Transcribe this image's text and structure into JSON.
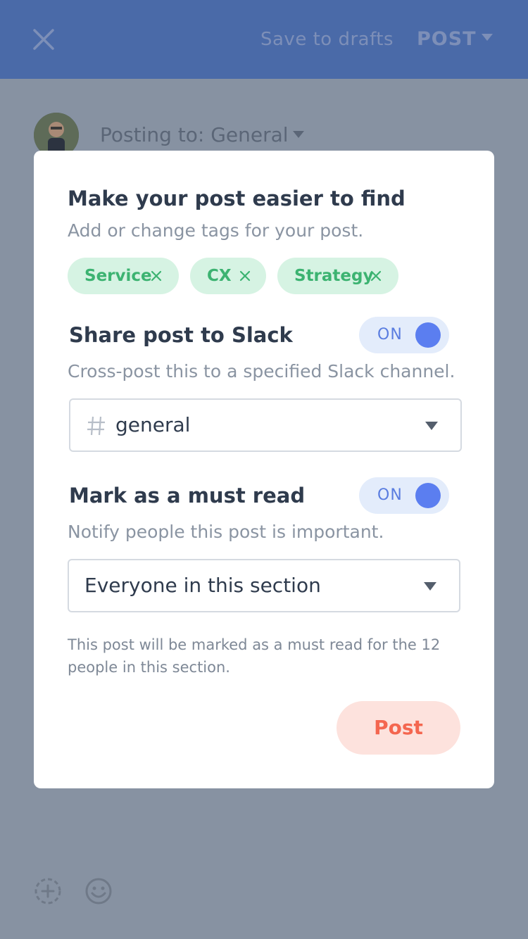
{
  "header": {
    "save_drafts": "Save to drafts",
    "post": "POST"
  },
  "composer": {
    "posting_to": "Posting to: General"
  },
  "modal": {
    "tags_title": "Make your post easier to find",
    "tags_subtitle": "Add or change tags for your post.",
    "tags": [
      {
        "label": "Service"
      },
      {
        "label": "CX"
      },
      {
        "label": "Strategy"
      }
    ],
    "slack": {
      "title": "Share post to Slack",
      "toggle": "ON",
      "subtitle": "Cross-post this to a specified Slack channel.",
      "channel": "general"
    },
    "must_read": {
      "title": "Mark as a must read",
      "toggle": "ON",
      "subtitle": "Notify people this post is important.",
      "audience": "Everyone in this section",
      "note": "This post will be marked as a must read for the 12 people in this section."
    },
    "post_button": "Post"
  },
  "colors": {
    "header_bar": "#4a6aa8",
    "overlay": "#8792a2",
    "tag_background": "#d6f3e3",
    "tag_text": "#3cb371",
    "toggle_background": "#e3ecfb",
    "toggle_knob": "#5b7ef0",
    "post_button_background": "#fde2dd",
    "post_button_text": "#f4664f"
  },
  "icons": {
    "close": "close-icon",
    "tag_remove": "close-icon",
    "channel": "hash-icon",
    "dropdown": "caret-down-icon",
    "add_media": "add-circle-icon",
    "emoji": "smiley-icon"
  }
}
